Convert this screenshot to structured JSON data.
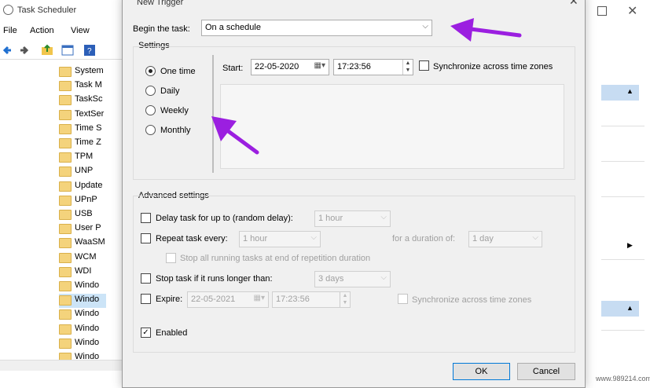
{
  "background_window": {
    "title": "Task Scheduler",
    "menu": [
      "File",
      "Action",
      "View"
    ],
    "tree_items": [
      {
        "label": "System",
        "selected": false
      },
      {
        "label": "Task M",
        "selected": false
      },
      {
        "label": "TaskSc",
        "selected": false
      },
      {
        "label": "TextSer",
        "selected": false
      },
      {
        "label": "Time S",
        "selected": false
      },
      {
        "label": "Time Z",
        "selected": false
      },
      {
        "label": "TPM",
        "selected": false
      },
      {
        "label": "UNP",
        "selected": false
      },
      {
        "label": "Update",
        "selected": false
      },
      {
        "label": "UPnP",
        "selected": false
      },
      {
        "label": "USB",
        "selected": false
      },
      {
        "label": "User P",
        "selected": false
      },
      {
        "label": "WaaSM",
        "selected": false
      },
      {
        "label": "WCM",
        "selected": false
      },
      {
        "label": "WDI",
        "selected": false
      },
      {
        "label": "Windo",
        "selected": false
      },
      {
        "label": "Windo",
        "selected": true
      },
      {
        "label": "Windo",
        "selected": false
      },
      {
        "label": "Windo",
        "selected": false
      },
      {
        "label": "Windo",
        "selected": false
      },
      {
        "label": "Windo",
        "selected": false
      }
    ]
  },
  "dialog": {
    "title": "New Trigger",
    "begin_task": {
      "label": "Begin the task:",
      "value": "On a schedule"
    },
    "settings": {
      "group_label": "Settings",
      "schedule_options": [
        {
          "label": "One time",
          "checked": true
        },
        {
          "label": "Daily",
          "checked": false
        },
        {
          "label": "Weekly",
          "checked": false
        },
        {
          "label": "Monthly",
          "checked": false
        }
      ],
      "start_label": "Start:",
      "start_date": "22-05-2020",
      "start_time": "17:23:56",
      "sync_label": "Synchronize across time zones"
    },
    "advanced": {
      "group_label": "Advanced settings",
      "delay_label": "Delay task for up to (random delay):",
      "delay_value": "1 hour",
      "repeat_label": "Repeat task every:",
      "repeat_value": "1 hour",
      "duration_label": "for a duration of:",
      "duration_value": "1 day",
      "stop_all_label": "Stop all running tasks at end of repetition duration",
      "stop_longer_label": "Stop task if it runs longer than:",
      "stop_longer_value": "3 days",
      "expire_label": "Expire:",
      "expire_date": "22-05-2021",
      "expire_time": "17:23:56",
      "expire_sync_label": "Synchronize across time zones",
      "enabled_label": "Enabled"
    },
    "buttons": {
      "ok": "OK",
      "cancel": "Cancel"
    }
  },
  "annotation_color": "#9b1fe0",
  "watermark": "www.989214.com"
}
